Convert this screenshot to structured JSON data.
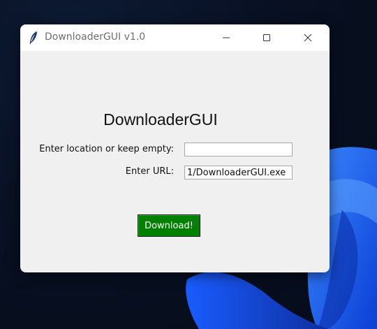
{
  "window": {
    "title": "DownloaderGUI v1.0",
    "controls": {
      "minimize_icon": "minimize-icon",
      "maximize_icon": "maximize-icon",
      "close_icon": "close-icon"
    },
    "app_icon": "feather-icon"
  },
  "form": {
    "heading": "DownloaderGUI",
    "location_label": "Enter location or keep empty:",
    "location_value": "",
    "url_label": "Enter URL:",
    "url_value": "1/DownloaderGUI.exe",
    "download_button": "Download!"
  },
  "colors": {
    "button_bg": "#008000",
    "button_text": "#ffffff",
    "window_bg": "#f0f0f0",
    "desktop_bg": "#081022",
    "wallpaper_accent": "#1e63ff"
  }
}
